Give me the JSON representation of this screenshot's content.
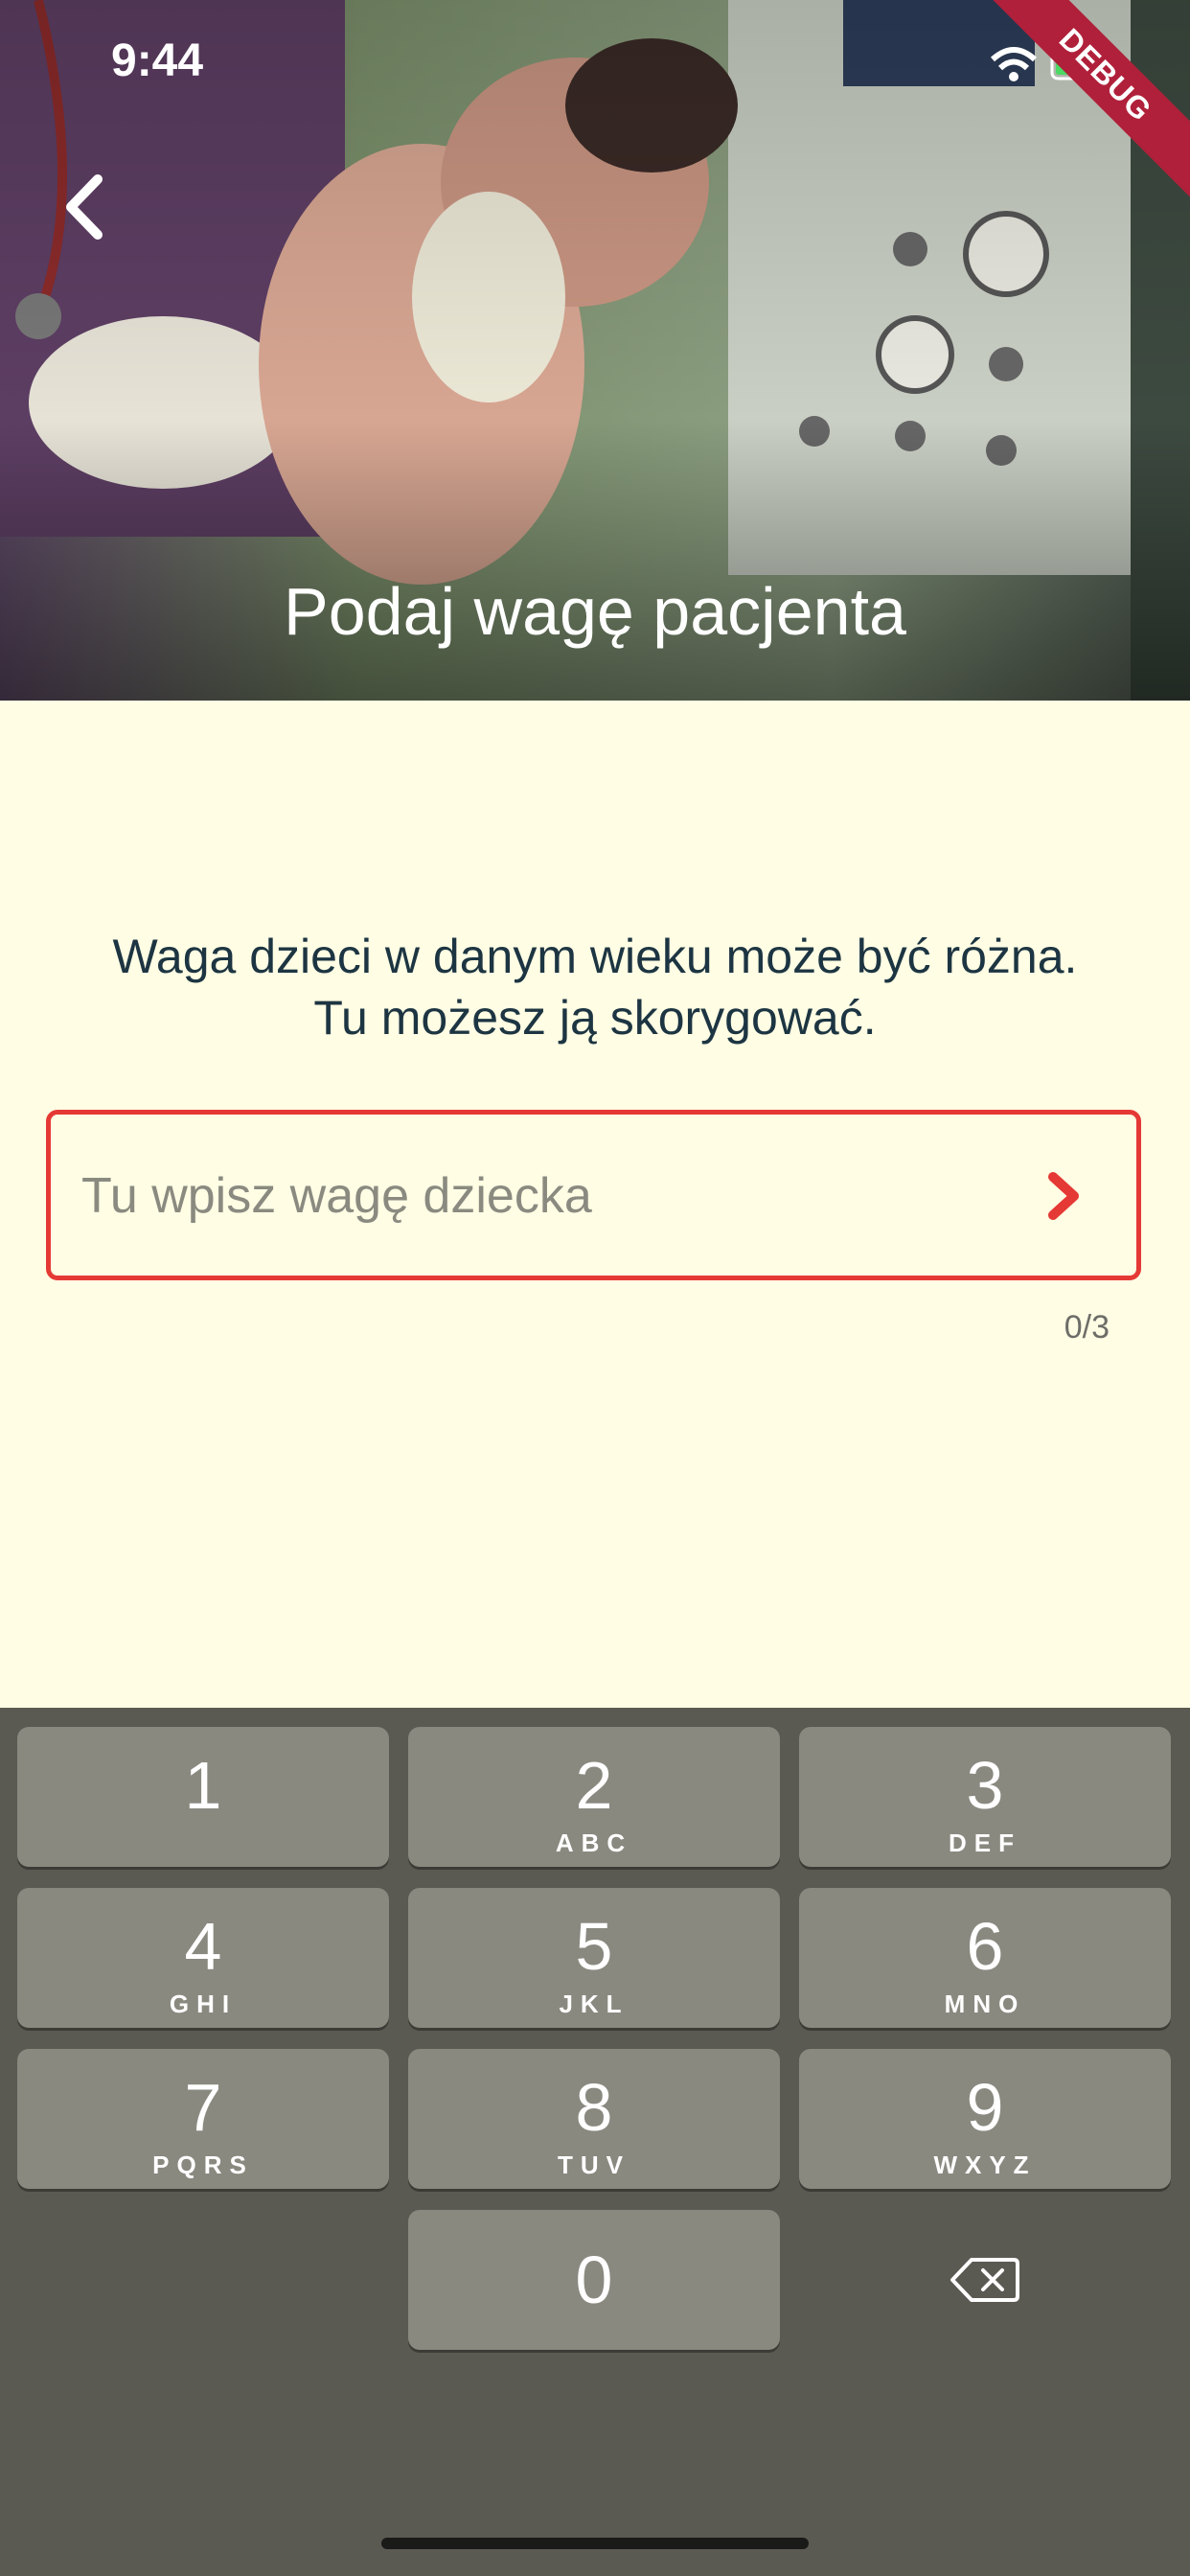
{
  "status_bar": {
    "time": "9:44",
    "debug_label": "DEBUG"
  },
  "header": {
    "title": "Podaj wagę pacjenta"
  },
  "info": {
    "line1": "Waga dzieci w danym wieku może być różna.",
    "line2": "Tu możesz ją skorygować."
  },
  "weight_input": {
    "placeholder": "Tu wpisz wagę dziecka",
    "value": "",
    "counter": "0/3"
  },
  "keypad": {
    "keys": [
      {
        "digit": "1",
        "letters": ""
      },
      {
        "digit": "2",
        "letters": "ABC"
      },
      {
        "digit": "3",
        "letters": "DEF"
      },
      {
        "digit": "4",
        "letters": "GHI"
      },
      {
        "digit": "5",
        "letters": "JKL"
      },
      {
        "digit": "6",
        "letters": "MNO"
      },
      {
        "digit": "7",
        "letters": "PQRS"
      },
      {
        "digit": "8",
        "letters": "TUV"
      },
      {
        "digit": "9",
        "letters": "WXYZ"
      },
      {
        "digit": "0",
        "letters": ""
      }
    ],
    "delete_icon": "backspace-icon"
  },
  "colors": {
    "background": "#FFFDE4",
    "accent": "#e53935",
    "text": "#1d3542",
    "keypad_bg": "#5b5a52",
    "key_bg": "#8a8980"
  }
}
